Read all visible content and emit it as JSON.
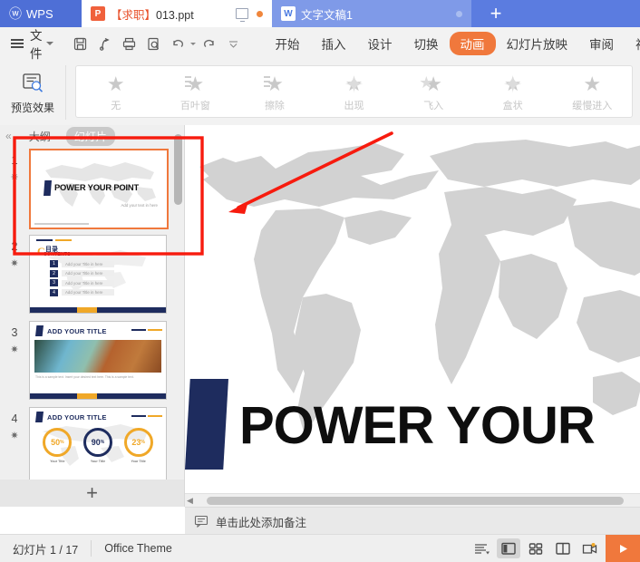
{
  "titlebar": {
    "app_name": "WPS",
    "tabs": [
      {
        "label_prefix": "【求职】",
        "label_rest": "013.ppt",
        "icon": "powerpoint-icon",
        "active": true
      },
      {
        "label_prefix": "",
        "label_rest": "文字文稿1",
        "icon": "word-icon",
        "active": false
      }
    ],
    "monitor_icon": "monitor-icon",
    "status_dot": "dot-indicator",
    "new_tab_label": "+"
  },
  "menubar": {
    "file_label": "文件",
    "quick_access": [
      {
        "name": "save-icon"
      },
      {
        "name": "share-icon"
      },
      {
        "name": "print-icon"
      },
      {
        "name": "print-preview-icon"
      },
      {
        "name": "undo-icon"
      },
      {
        "name": "redo-icon"
      },
      {
        "name": "customize-icon"
      }
    ],
    "ribbon_tabs": [
      {
        "label": "开始",
        "active": false
      },
      {
        "label": "插入",
        "active": false
      },
      {
        "label": "设计",
        "active": false
      },
      {
        "label": "切换",
        "active": false
      },
      {
        "label": "动画",
        "active": true
      },
      {
        "label": "幻灯片放映",
        "active": false
      },
      {
        "label": "审阅",
        "active": false
      },
      {
        "label": "视图",
        "active": false
      }
    ],
    "accent_color": "#f0783c"
  },
  "ribbon": {
    "preview_button": {
      "label": "预览效果",
      "icon": "preview-effect-icon"
    },
    "effects": [
      {
        "label": "无",
        "icon": "star-plain-icon"
      },
      {
        "label": "百叶窗",
        "icon": "star-blinds-icon"
      },
      {
        "label": "擦除",
        "icon": "star-wipe-icon"
      },
      {
        "label": "出现",
        "icon": "star-appear-icon"
      },
      {
        "label": "飞入",
        "icon": "star-flyin-icon"
      },
      {
        "label": "盒状",
        "icon": "star-box-icon"
      },
      {
        "label": "缓慢进入",
        "icon": "star-slow-icon"
      }
    ]
  },
  "leftpanel": {
    "collapse_label": "«",
    "tabs": [
      {
        "label": "大纲",
        "active": false
      },
      {
        "label": "幻灯片",
        "active": true
      }
    ],
    "slides": [
      {
        "number": "1",
        "animated": "✷",
        "selected": true,
        "title": "POWER YOUR POINT",
        "subtitle": "Add your text in here"
      },
      {
        "number": "2",
        "animated": "✷",
        "selected": false,
        "title": "目录",
        "subtitle": "CONTENTS",
        "items": [
          "Add your Title in here",
          "Add your Title in here",
          "Add your Title in here",
          "Add your Title in here"
        ],
        "item_numbers": [
          "1",
          "2",
          "3",
          "4"
        ]
      },
      {
        "number": "3",
        "animated": "✷",
        "selected": false,
        "title": "ADD YOUR TITLE",
        "subtitle": "This is a sample text. Insert your desired text here. This is a sample text."
      },
      {
        "number": "4",
        "animated": "✷",
        "selected": false,
        "title": "ADD YOUR TITLE",
        "stats": [
          {
            "value": "50",
            "unit": "%",
            "label": "Your Title"
          },
          {
            "value": "90",
            "unit": "%",
            "label": "Your Title"
          },
          {
            "value": "23",
            "unit": "%",
            "label": "Your Title"
          }
        ]
      }
    ],
    "add_slide_label": "+"
  },
  "main_slide": {
    "title": "POWER YOUR",
    "background": "world-map",
    "annotation": {
      "type": "arrow-and-rectangle",
      "color": "#f71b0e"
    }
  },
  "notes": {
    "placeholder": "单击此处添加备注",
    "icon": "notes-icon"
  },
  "statusbar": {
    "slide_counter": "幻灯片 1 / 17",
    "theme_name": "Office Theme",
    "view_buttons": [
      {
        "name": "outline-view-icon",
        "active": false
      },
      {
        "name": "normal-view-icon",
        "active": true
      },
      {
        "name": "slide-sorter-icon",
        "active": false
      },
      {
        "name": "reading-view-icon",
        "active": false
      },
      {
        "name": "presenter-view-icon",
        "active": false
      }
    ],
    "play_button": {
      "name": "play-slideshow-button",
      "label": "▶"
    }
  }
}
